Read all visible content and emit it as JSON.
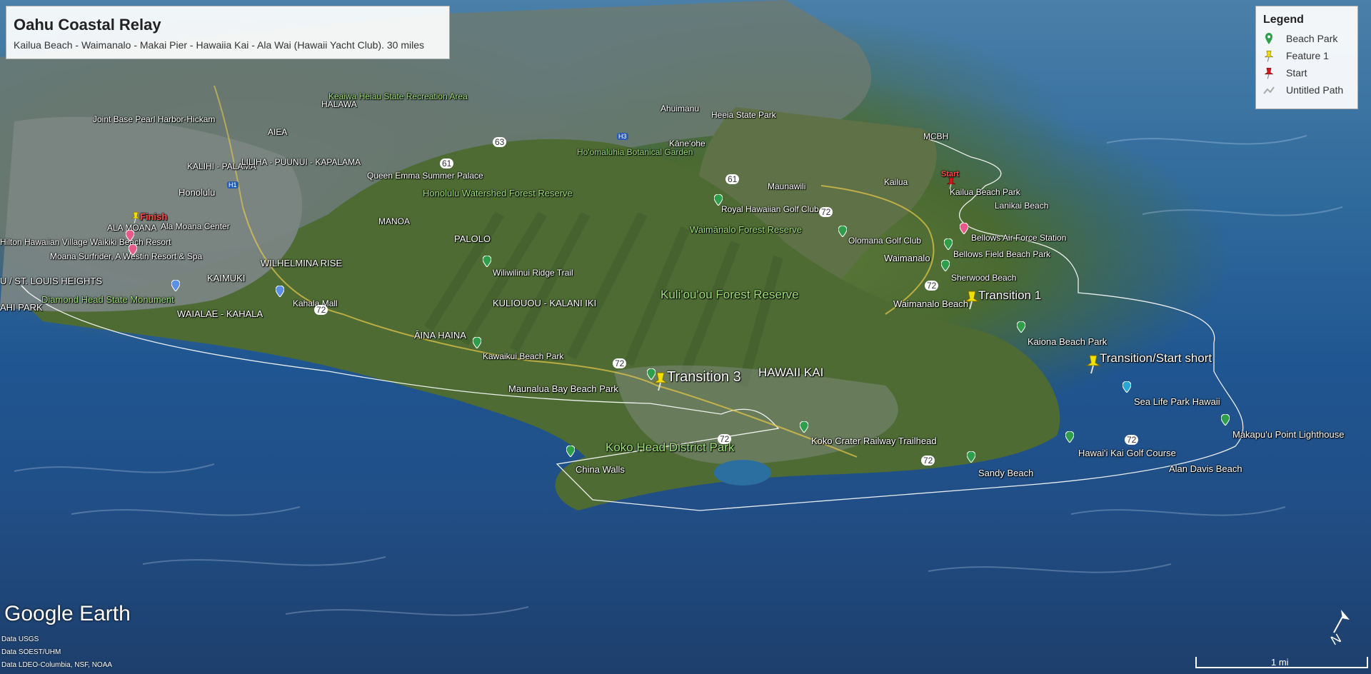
{
  "panel": {
    "title": "Oahu Coastal Relay",
    "subtitle": "Kailua Beach - Waimanalo - Makai Pier - Hawaiia Kai - Ala Wai (Hawaii Yacht Club). 30 miles"
  },
  "legend": {
    "heading": "Legend",
    "items": [
      {
        "label": "Beach Park",
        "icon": "green-pin-icon",
        "color": "#2e9e4a"
      },
      {
        "label": "Feature 1",
        "icon": "yellow-pushpin-icon",
        "color": "#f2e000"
      },
      {
        "label": "Start",
        "icon": "red-pushpin-icon",
        "color": "#e0141e"
      },
      {
        "label": "Untitled Path",
        "icon": "path-icon",
        "color": "#aaaaaa"
      }
    ]
  },
  "pushpins": {
    "start": "Start",
    "finish": "Finish",
    "transition1": "Transition 1",
    "transition3": "Transition 3",
    "transition_short": "Transition/Start short"
  },
  "places": {
    "honolulu": "Honolulu",
    "ala_moana": "ALA MOANA",
    "ala_moana_center": "Ala Moana Center",
    "hilton": "Hilton Hawaiian Village Waikiki Beach Resort",
    "moana": "Moana Surfrider, A Westin Resort & Spa",
    "st_louis": "U / ST. LOUIS HEIGHTS",
    "kahi_park": "AHI PARK",
    "diamond_head": "Diamond Head State Monument",
    "waialae": "WAIALAE - KAHALA",
    "kahala_mall": "Kahala Mall",
    "kaimuki": "KAIMUKI",
    "wilhelmina": "WILHELMINA RISE",
    "manoa": "MANOA",
    "palolo": "PALOLO",
    "kuliouou": "KULIOUOU - KALANI IKI",
    "aina_haina": "ĀINA HAINA",
    "kawaikui": "Kawaikui Beach Park",
    "maunalua": "Maunalua Bay Beach Park",
    "hawaii_kai": "HAWAII KAI",
    "koko_head": "Koko Head District Park",
    "china_walls": "China Walls",
    "koko_crater": "Koko Crater Railway Trailhead",
    "sandy_beach": "Sandy Beach",
    "hawaii_kai_golf": "Hawai'i Kai Golf Course",
    "alan_davis": "Alan Davis Beach",
    "makapuu": "Makapu'u Point Lighthouse",
    "sea_life": "Sea Life Park Hawaii",
    "kaiona": "Kaiona Beach Park",
    "waimanalo_beach": "Waimanalo Beach",
    "waimanalo": "Waimanalo",
    "sherwood": "Sherwood Beach",
    "bellows_park": "Bellows Field Beach Park",
    "bellows_afs": "Bellows Air Force Station",
    "lanikai": "Lanikai Beach",
    "kailua_beach": "Kailua Beach Park",
    "kailua": "Kailua",
    "maunawili": "Maunawili",
    "mcbh": "MCBH",
    "olomana": "Olomana Golf Club",
    "royal_hawaiian": "Royal Hawaiian Golf Club",
    "waimanalo_forest": "Waimānalo Forest Reserve",
    "kuliouou_forest": "Kuli'ou'ou Forest Reserve",
    "wiliwilinui": "Wiliwilinui Ridge Trail",
    "honolulu_watershed": "Honolulu Watershed Forest Reserve",
    "queen_emma": "Queen Emma Summer Palace",
    "hoomaluhia": "Ho'omaluhia Botanical Garden",
    "kaneohe": "Kāneʻohe",
    "kalihi": "KALIHI - PALAMA",
    "liliha": "LILIHA - PUUNUI - KAPALAMA",
    "joint_base": "Joint Base Pearl Harbor-Hickam",
    "keaiwa": "Keaiwa Heiau State Recreation Area",
    "aiea": "AIEA",
    "halawa": "HALAWA",
    "kaneohe_state_park": "Heeia State Park",
    "ahuimanu": "Ahuimanu",
    "route_72": "72",
    "route_61": "61",
    "route_63": "63",
    "route_h1": "H1",
    "route_h3": "H3"
  },
  "footer": {
    "logo": "Google Earth",
    "attr1": "Data USGS",
    "attr2": "Data SOEST/UHM",
    "attr3": "Data LDEO-Columbia, NSF, NOAA",
    "scale": "1 mi"
  },
  "colors": {
    "beach_pin": "#2e9e4a",
    "pushpin": "#f2e000",
    "start_pin": "#e0141e",
    "route_line": "#ffffff",
    "green_label": "#9fe07a"
  }
}
